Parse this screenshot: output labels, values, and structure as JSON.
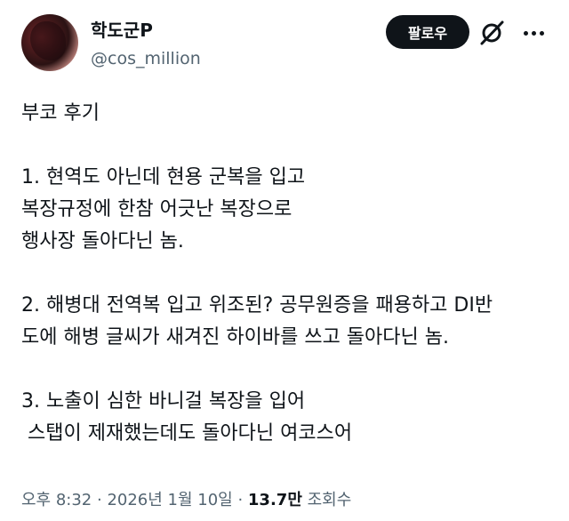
{
  "user": {
    "display_name": "학도군P",
    "handle": "@cos_million"
  },
  "actions": {
    "follow_label": "팔로우",
    "grok_icon": "grok-icon",
    "more_icon": "more-icon"
  },
  "tweet": {
    "line1": "부코 후기",
    "line2": "1. 현역도 아닌데 현용 군복을 입고",
    "line3": "복장규정에 한참 어긋난 복장으로",
    "line4": "행사장 돌아다닌 놈.",
    "line5": "2. 해병대 전역복 입고 위조된? 공무원증을 패용하고 DI반",
    "line6": "도에 해병 글씨가 새겨진 하이바를 쓰고 돌아다닌 놈.",
    "line7": "3. 노출이 심한 바니걸 복장을 입어",
    "line8": " 스탭이 제재했는데도 돌아다닌 여코스어"
  },
  "meta": {
    "time": "오후 8:32",
    "sep1": " · ",
    "date": "2026년 1월 10일",
    "sep2": " · ",
    "views": "13.7만",
    "views_label": " 조회수"
  }
}
